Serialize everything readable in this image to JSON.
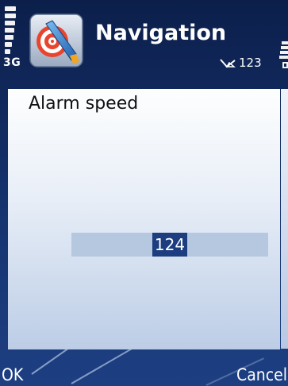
{
  "status": {
    "network_type": "3G",
    "message_count": "123"
  },
  "header": {
    "title": "Navigation",
    "app_icon": "navigation-target-icon"
  },
  "dialog": {
    "title": "Alarm speed",
    "value": "124"
  },
  "softkeys": {
    "left": "OK",
    "right": "Cancel"
  },
  "colors": {
    "background": "#16336f",
    "selection": "#1c3d7f",
    "field": "#b5c8e0"
  }
}
